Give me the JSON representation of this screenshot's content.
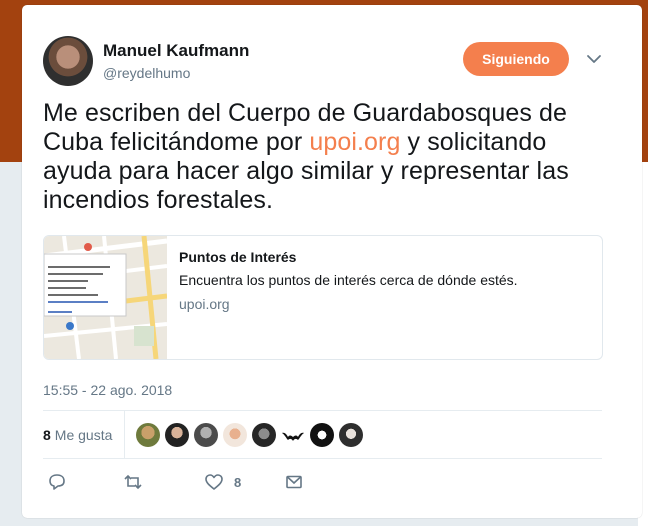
{
  "tweet": {
    "author": {
      "name": "Manuel Kaufmann",
      "handle": "@reydelhumo"
    },
    "follow_button": "Siguiendo",
    "text_parts": {
      "before": "Me escriben del Cuerpo de Guardabosques de Cuba felicitándome por ",
      "link": "upoi.org",
      "after": " y solicitando ayuda para hacer algo similar y representar las incendios forestales."
    },
    "link_card": {
      "title": "Puntos de Interés",
      "description": "Encuentra los puntos de interés cerca de dónde estés.",
      "domain": "upoi.org"
    },
    "timestamp": "15:55 - 22 ago. 2018",
    "likes": {
      "count": "8",
      "label": "Me gusta"
    },
    "actions": {
      "like_count": "8"
    }
  },
  "colors": {
    "accent": "#f47f4d",
    "header_bg": "#a3420f",
    "muted": "#657786"
  },
  "icons": [
    "chevron-down-icon",
    "reply-icon",
    "retweet-icon",
    "heart-icon",
    "message-icon"
  ]
}
